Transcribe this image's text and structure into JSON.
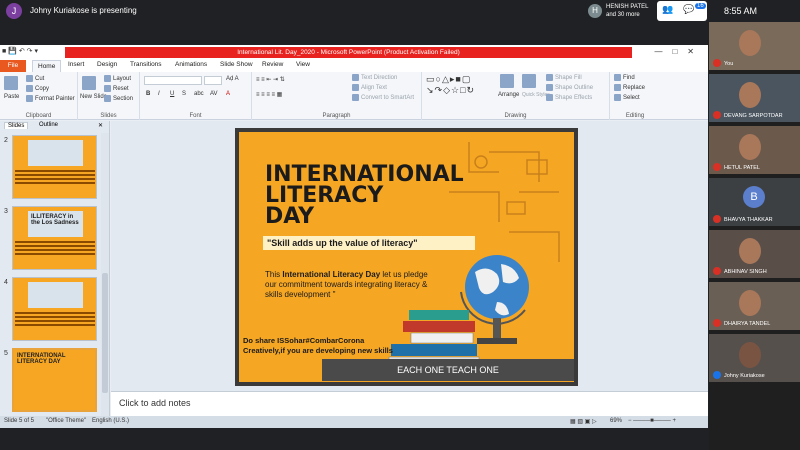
{
  "meet": {
    "presenter_initial": "J",
    "presenting_text": "Johny Kuriakose is presenting",
    "participants_initial": "H",
    "participants_line1": "HENISH PATEL",
    "participants_line2": "and 30 more",
    "chat_count": "16",
    "clock": "8:55",
    "clock_ampm": "AM",
    "self_label": "You"
  },
  "ppt": {
    "window_title": "International Lit. Day_2020  -  Microsoft PowerPoint (Product Activation Failed)",
    "tabs": [
      "File",
      "Home",
      "Insert",
      "Design",
      "Transitions",
      "Animations",
      "Slide Show",
      "Review",
      "View"
    ],
    "clipboard": {
      "paste": "Paste",
      "cut": "Cut",
      "copy": "Copy",
      "format_painter": "Format Painter",
      "label": "Clipboard"
    },
    "slides_group": {
      "new_slide": "New Slide",
      "layout": "Layout",
      "reset": "Reset",
      "section": "Section",
      "label": "Slides"
    },
    "font_group": {
      "label": "Font"
    },
    "paragraph_group": {
      "text_direction": "Text Direction",
      "align_text": "Align Text",
      "convert": "Convert to SmartArt",
      "label": "Paragraph"
    },
    "drawing_group": {
      "arrange": "Arrange",
      "quick_styles": "Quick Styles",
      "shape_fill": "Shape Fill",
      "shape_outline": "Shape Outline",
      "shape_effects": "Shape Effects",
      "label": "Drawing"
    },
    "editing_group": {
      "find": "Find",
      "replace": "Replace",
      "select": "Select",
      "label": "Editing"
    },
    "pane_tabs": {
      "slides": "Slides",
      "outline": "Outline"
    },
    "thumb_numbers": [
      "2",
      "3",
      "4",
      "5"
    ],
    "thumb_titles": [
      "",
      "ILLITERACY in the Los Sadness",
      "",
      "INTERNATIONAL LITERACY DAY"
    ],
    "notes_placeholder": "Click to add notes",
    "status": {
      "slide": "Slide 5 of 5",
      "theme": "\"Office Theme\"",
      "language": "English (U.S.)",
      "zoom": "69%"
    }
  },
  "slide": {
    "title_lines": [
      "INTERNATIONAL",
      "LITERACY",
      "DAY"
    ],
    "tagline": "\"Skill adds up the value of literacy\"",
    "pledge_pre": "This ",
    "pledge_bold": "International Literacy Day",
    "pledge_rest": "let us pledge our commitment towards integrating literacy & skills development \"",
    "cta": "Do share  ISSohar#CombarCorona Creatively,if you are developing new skills",
    "banner": "EACH ONE TEACH ONE"
  },
  "participants": [
    {
      "name": "You"
    },
    {
      "name": "DEVANG SARPOTDAR"
    },
    {
      "name": "HETUL PATEL"
    },
    {
      "name": "BHAVYA THAKKAR",
      "initial": "B"
    },
    {
      "name": "ABHINAV SINGH"
    },
    {
      "name": "DHAIRYA TANDEL"
    },
    {
      "name": "Johny Kuriakose"
    }
  ]
}
